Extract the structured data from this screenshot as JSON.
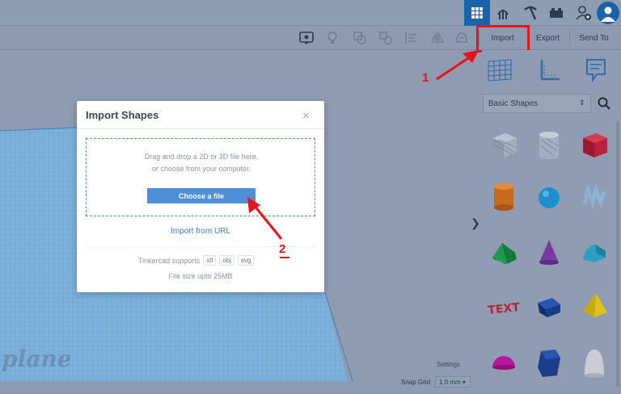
{
  "toolbar": {
    "import_label": "Import",
    "export_label": "Export",
    "sendto_label": "Send To"
  },
  "workplane": {
    "watermark": "plane",
    "settings_label": "Settings",
    "snap_grid_label": "Snap Grid",
    "snap_grid_value": "1.0 mm"
  },
  "panel": {
    "library_selected": "Basic Shapes",
    "shapes": [
      {
        "name": "box-striped",
        "color": "#a8b3c4"
      },
      {
        "name": "cylinder-striped",
        "color": "#a8b3c4"
      },
      {
        "name": "box",
        "color": "#b8213f"
      },
      {
        "name": "cylinder",
        "color": "#c46a1e"
      },
      {
        "name": "sphere",
        "color": "#1d8fcf"
      },
      {
        "name": "scribble",
        "color": "#8fb0d4"
      },
      {
        "name": "roof",
        "color": "#1f9a52"
      },
      {
        "name": "cone",
        "color": "#7a3aa4"
      },
      {
        "name": "round-roof",
        "color": "#2d9fc2"
      },
      {
        "name": "text",
        "color": "#b8213f"
      },
      {
        "name": "wedge",
        "color": "#1a3c8a"
      },
      {
        "name": "pyramid",
        "color": "#e0c21a"
      },
      {
        "name": "half-sphere",
        "color": "#b5199a"
      },
      {
        "name": "polygon",
        "color": "#1a3c8a"
      },
      {
        "name": "paraboloid",
        "color": "#c8ccd4"
      }
    ]
  },
  "modal": {
    "title": "Import Shapes",
    "close": "×",
    "drop_line1": "Drag and drop a 2D or 3D file here,",
    "drop_line2": "or choose from your computer.",
    "choose_button": "Choose a file",
    "import_url": "Import from URL",
    "supports_label": "Tinkercad supports",
    "formats": [
      "stl",
      "obj",
      "svg"
    ],
    "filesize": "File size upto 25MB"
  },
  "annotations": {
    "step1": "1",
    "step2": "2",
    "color": "#e8141a"
  }
}
